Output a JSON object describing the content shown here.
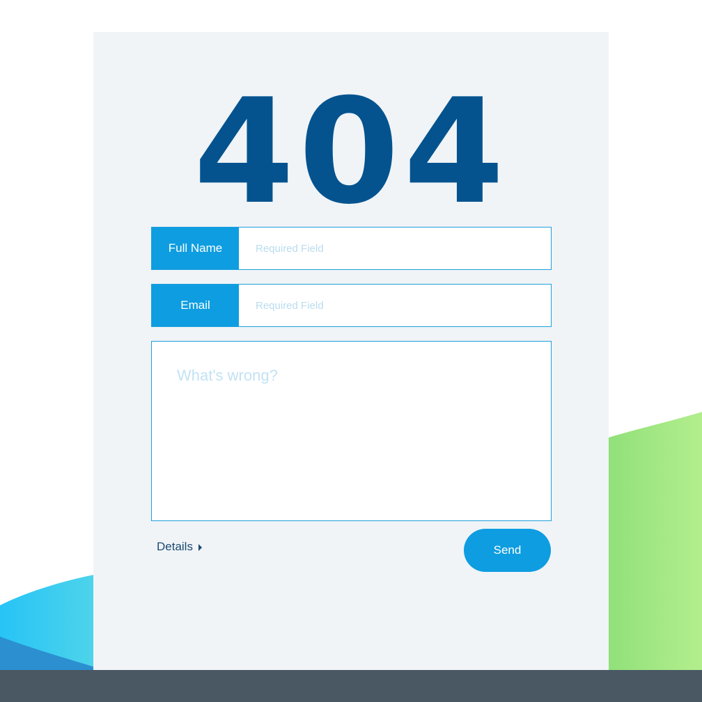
{
  "error": {
    "code": "404"
  },
  "form": {
    "full_name": {
      "label": "Full Name",
      "placeholder": "Required Field",
      "value": ""
    },
    "email": {
      "label": "Email",
      "placeholder": "Required Field",
      "value": ""
    },
    "message": {
      "placeholder": "What's wrong?",
      "value": ""
    },
    "details_label": "Details",
    "send_label": "Send"
  },
  "icons": {
    "details_caret": "caret-right-icon"
  },
  "colors": {
    "brand_dark": "#04538f",
    "accent": "#0e9de0",
    "card_bg": "#f0f4f7",
    "footer": "#4a5864"
  }
}
